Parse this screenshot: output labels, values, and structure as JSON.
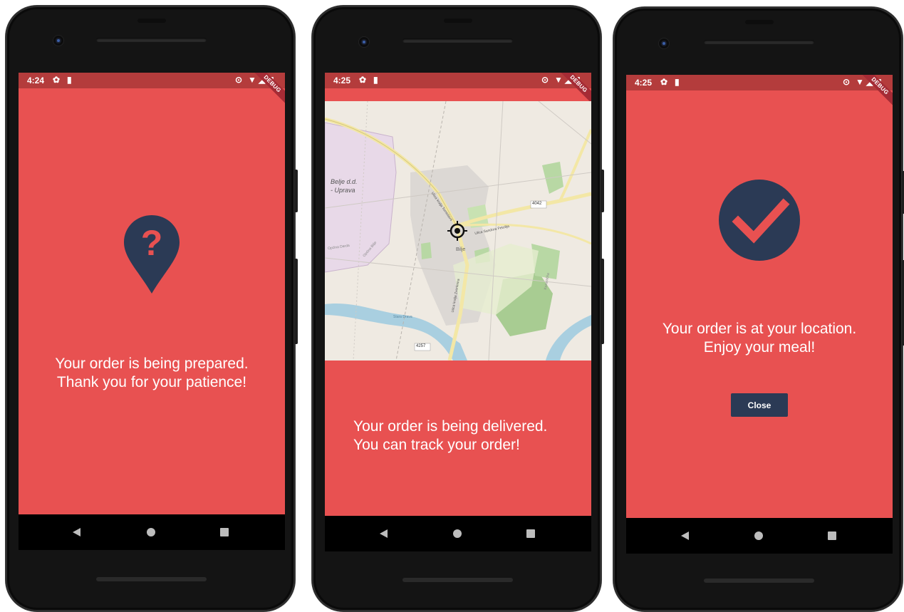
{
  "screens": [
    {
      "status_time": "4:24",
      "debug_label": "DEBUG",
      "icon": "question-location-pin-icon",
      "message_line1": "Your order is being prepared.",
      "message_line2": "Thank you for your patience!"
    },
    {
      "status_time": "4:25",
      "debug_label": "DEBUG",
      "map": {
        "labels": [
          "Belje d.d.",
          "- Uprava",
          "4042",
          "4257",
          "Ulica kralja Tomislava",
          "Ulica Sandora Petofija",
          "Ulica kralja Zvonimira",
          "Općina Darda",
          "Općina Bilje",
          "Bilje",
          "Stara Drava",
          "Kozaračka"
        ]
      },
      "message_line1": "Your order is being delivered.",
      "message_line2": "You can track your order!"
    },
    {
      "status_time": "4:25",
      "debug_label": "DEBUG",
      "icon": "checkmark-circle-icon",
      "message_line1": "Your order is at your location.",
      "message_line2": "Enjoy your meal!",
      "close_label": "Close"
    }
  ],
  "colors": {
    "screen_bg": "#e85151",
    "statusbar_bg": "#b43c3c",
    "icon_navy": "#2b3a55",
    "phone_body": "#141414"
  }
}
